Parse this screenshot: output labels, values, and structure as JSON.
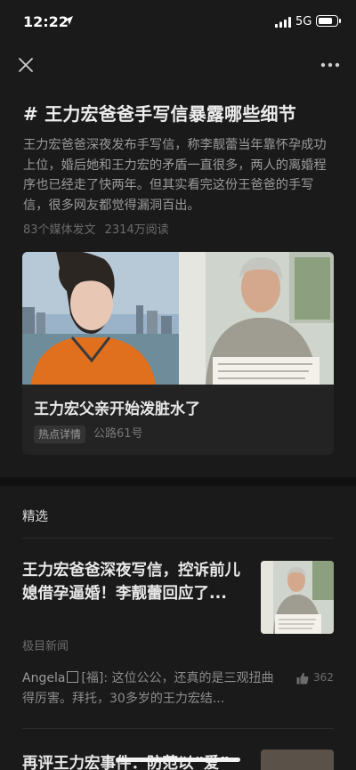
{
  "status_bar": {
    "time": "12:22",
    "network": "5G",
    "battery_level": 0.85
  },
  "nav": {
    "close_icon": "close-icon",
    "more_icon": "more-icon"
  },
  "topic": {
    "title": "# 王力宏爸爸手写信暴露哪些细节",
    "description": "王力宏爸爸深夜发布手写信，称李靓蕾当年靠怀孕成功上位，婚后她和王力宏的矛盾一直很多，两人的离婚程序也已经走了快两年。但其实看完这份王爸爸的手写信，很多网友都觉得漏洞百出。",
    "media_count": "83个媒体发文",
    "reads": "2314万阅读"
  },
  "hot_card": {
    "title": "王力宏父亲开始泼脏水了",
    "tag": "热点详情",
    "source": "公路61号"
  },
  "featured": {
    "section_title": "精选",
    "articles": [
      {
        "title": "王力宏爸爸深夜写信，控诉前儿媳借孕逼婚！李靓蕾回应了...",
        "source": "极目新闻",
        "comment": {
          "author": "Angela",
          "badge": "[福]",
          "text": ": 这位公公，还真的是三观扭曲得厉害。拜托，30多岁的王力宏结...",
          "likes": "362"
        }
      },
      {
        "title": "再评王力宏事件：防范以“爱”"
      }
    ]
  },
  "colors": {
    "background": "#1a1a1a",
    "card": "#232323",
    "text_primary": "#e8e8e8",
    "text_secondary": "#9a9a9a"
  }
}
